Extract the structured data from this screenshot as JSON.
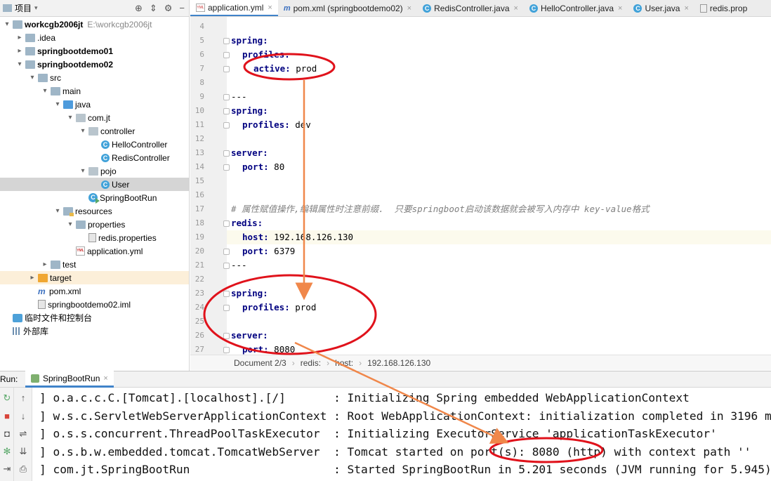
{
  "project_panel": {
    "title": "项目",
    "tree": [
      {
        "label": "workcgb2006jt",
        "path": "E:\\workcgb2006jt",
        "bold": true,
        "depth": 0,
        "arrow": "▾",
        "icon": "folder-icon"
      },
      {
        "label": ".idea",
        "depth": 1,
        "arrow": "▸",
        "icon": "folder-icon"
      },
      {
        "label": "springbootdemo01",
        "bold": true,
        "depth": 1,
        "arrow": "▸",
        "icon": "folder-icon"
      },
      {
        "label": "springbootdemo02",
        "bold": true,
        "depth": 1,
        "arrow": "▾",
        "icon": "folder-icon"
      },
      {
        "label": "src",
        "depth": 2,
        "arrow": "▾",
        "icon": "folder-icon"
      },
      {
        "label": "main",
        "depth": 3,
        "arrow": "▾",
        "icon": "folder-icon"
      },
      {
        "label": "java",
        "depth": 4,
        "arrow": "▾",
        "icon": "source-folder-icon"
      },
      {
        "label": "com.jt",
        "depth": 5,
        "arrow": "▾",
        "icon": "package-icon"
      },
      {
        "label": "controller",
        "depth": 6,
        "arrow": "▾",
        "icon": "package-icon"
      },
      {
        "label": "HelloController",
        "depth": 7,
        "arrow": "",
        "icon": "class-icon"
      },
      {
        "label": "RedisController",
        "depth": 7,
        "arrow": "",
        "icon": "class-icon"
      },
      {
        "label": "pojo",
        "depth": 6,
        "arrow": "▾",
        "icon": "package-icon"
      },
      {
        "label": "User",
        "depth": 7,
        "arrow": "",
        "icon": "class-icon",
        "selected": true
      },
      {
        "label": "SpringBootRun",
        "depth": 6,
        "arrow": "",
        "icon": "run-class-icon"
      },
      {
        "label": "resources",
        "depth": 4,
        "arrow": "▾",
        "icon": "resources-folder-icon"
      },
      {
        "label": "properties",
        "depth": 5,
        "arrow": "▾",
        "icon": "folder-icon"
      },
      {
        "label": "redis.properties",
        "depth": 6,
        "arrow": "",
        "icon": "properties-file-icon"
      },
      {
        "label": "application.yml",
        "depth": 5,
        "arrow": "",
        "icon": "yml-file-icon"
      },
      {
        "label": "test",
        "depth": 3,
        "arrow": "▸",
        "icon": "folder-icon"
      },
      {
        "label": "target",
        "depth": 2,
        "arrow": "▸",
        "icon": "excluded-folder-icon",
        "orange": true
      },
      {
        "label": "pom.xml",
        "depth": 2,
        "arrow": "",
        "icon": "maven-file-icon"
      },
      {
        "label": "springbootdemo02.iml",
        "depth": 2,
        "arrow": "",
        "icon": "iml-file-icon"
      },
      {
        "label": "临时文件和控制台",
        "depth": 0,
        "arrow": "",
        "icon": "scratches-icon"
      },
      {
        "label": "外部库",
        "depth": 0,
        "arrow": "",
        "icon": "library-icon"
      }
    ]
  },
  "editor": {
    "tabs": [
      {
        "label": "application.yml",
        "icon": "yml",
        "active": true
      },
      {
        "label": "pom.xml (springbootdemo02)",
        "icon": "m"
      },
      {
        "label": "RedisController.java",
        "icon": "c"
      },
      {
        "label": "HelloController.java",
        "icon": "c"
      },
      {
        "label": "User.java",
        "icon": "c"
      },
      {
        "label": "redis.prop",
        "icon": "f"
      }
    ],
    "lines": [
      {
        "n": "4",
        "key": "",
        "val": ""
      },
      {
        "n": "5",
        "key": "spring:",
        "val": "",
        "indent": 0,
        "fold": true
      },
      {
        "n": "6",
        "key": "profiles:",
        "val": "",
        "indent": 1,
        "fold": true
      },
      {
        "n": "7",
        "key": "active:",
        "val": " prod",
        "indent": 2,
        "fold": true
      },
      {
        "n": "8",
        "key": "",
        "val": ""
      },
      {
        "n": "9",
        "key": "",
        "val": "---",
        "fold": true
      },
      {
        "n": "10",
        "key": "spring:",
        "val": "",
        "indent": 0,
        "fold": true
      },
      {
        "n": "11",
        "key": "profiles:",
        "val": " dev",
        "indent": 1,
        "fold": true
      },
      {
        "n": "12",
        "key": "",
        "val": ""
      },
      {
        "n": "13",
        "key": "server:",
        "val": "",
        "indent": 0,
        "fold": true
      },
      {
        "n": "14",
        "key": "port:",
        "val": " 80",
        "indent": 1,
        "fold": true
      },
      {
        "n": "15",
        "key": "",
        "val": ""
      },
      {
        "n": "16",
        "key": "",
        "val": ""
      },
      {
        "n": "17",
        "key": "",
        "val": "",
        "comment": "# 属性赋值操作,编辑属性时注意前缀.  只要springboot启动该数据就会被写入内存中 key-value格式"
      },
      {
        "n": "18",
        "key": "redis:",
        "val": "",
        "indent": 0,
        "fold": true
      },
      {
        "n": "19",
        "key": "host:",
        "val": " 192.168.126.130",
        "indent": 1,
        "highlight": true
      },
      {
        "n": "20",
        "key": "port:",
        "val": " 6379",
        "indent": 1,
        "fold": true
      },
      {
        "n": "21",
        "key": "",
        "val": "---",
        "fold": true
      },
      {
        "n": "22",
        "key": "",
        "val": ""
      },
      {
        "n": "23",
        "key": "spring:",
        "val": "",
        "indent": 0,
        "fold": true
      },
      {
        "n": "24",
        "key": "profiles:",
        "val": " prod",
        "indent": 1,
        "fold": true
      },
      {
        "n": "25",
        "key": "",
        "val": ""
      },
      {
        "n": "26",
        "key": "server:",
        "val": "",
        "indent": 0,
        "fold": true
      },
      {
        "n": "27",
        "key": "port:",
        "val": " 8080",
        "indent": 1,
        "fold": true
      }
    ],
    "breadcrumb": [
      "Document 2/3",
      "redis:",
      "host:",
      "192.168.126.130"
    ]
  },
  "run_panel": {
    "label": "Run:",
    "tab": "SpringBootRun",
    "console": [
      "] o.a.c.c.C.[Tomcat].[localhost].[/]       : Initializing Spring embedded WebApplicationContext",
      "] w.s.c.ServletWebServerApplicationContext : Root WebApplicationContext: initialization completed in 3196 ms",
      "] o.s.s.concurrent.ThreadPoolTaskExecutor  : Initializing ExecutorService 'applicationTaskExecutor'",
      "] o.s.b.w.embedded.tomcat.TomcatWebServer  : Tomcat started on port(s): 8080 (http) with context path ''",
      "] com.jt.SpringBootRun                     : Started SpringBootRun in 5.201 seconds (JVM running for 5.945)"
    ]
  },
  "colors": {
    "annotation": "#e0121b",
    "arrow": "#f0874a",
    "yaml_key": "#000080",
    "accent": "#4083c9"
  }
}
